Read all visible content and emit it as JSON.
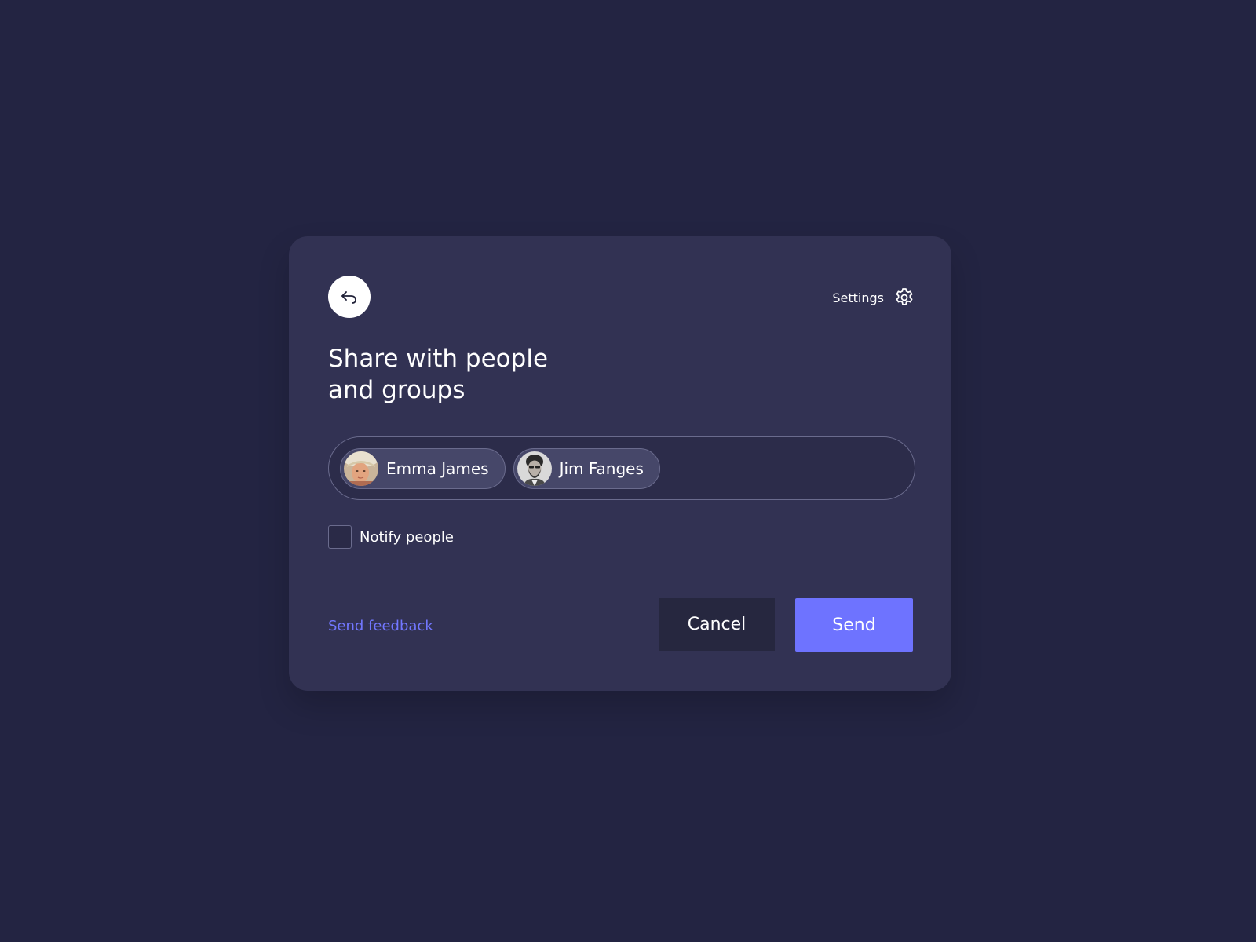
{
  "dialog": {
    "back_icon": "reply-arrow-icon",
    "settings_label": "Settings",
    "settings_icon": "gear-icon",
    "title_line1": "Share with people",
    "title_line2": "and groups",
    "recipients": [
      {
        "name": "Emma James",
        "avatar": "avatar-photo-emma"
      },
      {
        "name": "Jim Fanges",
        "avatar": "avatar-photo-jim"
      }
    ],
    "notify_label": "Notify people",
    "notify_checked": false,
    "feedback_link": "Send feedback",
    "cancel_label": "Cancel",
    "send_label": "Send"
  },
  "colors": {
    "page_background": "#232442",
    "dialog_background": "#323253",
    "accent": "#6e73ff",
    "link": "#7277ff"
  }
}
